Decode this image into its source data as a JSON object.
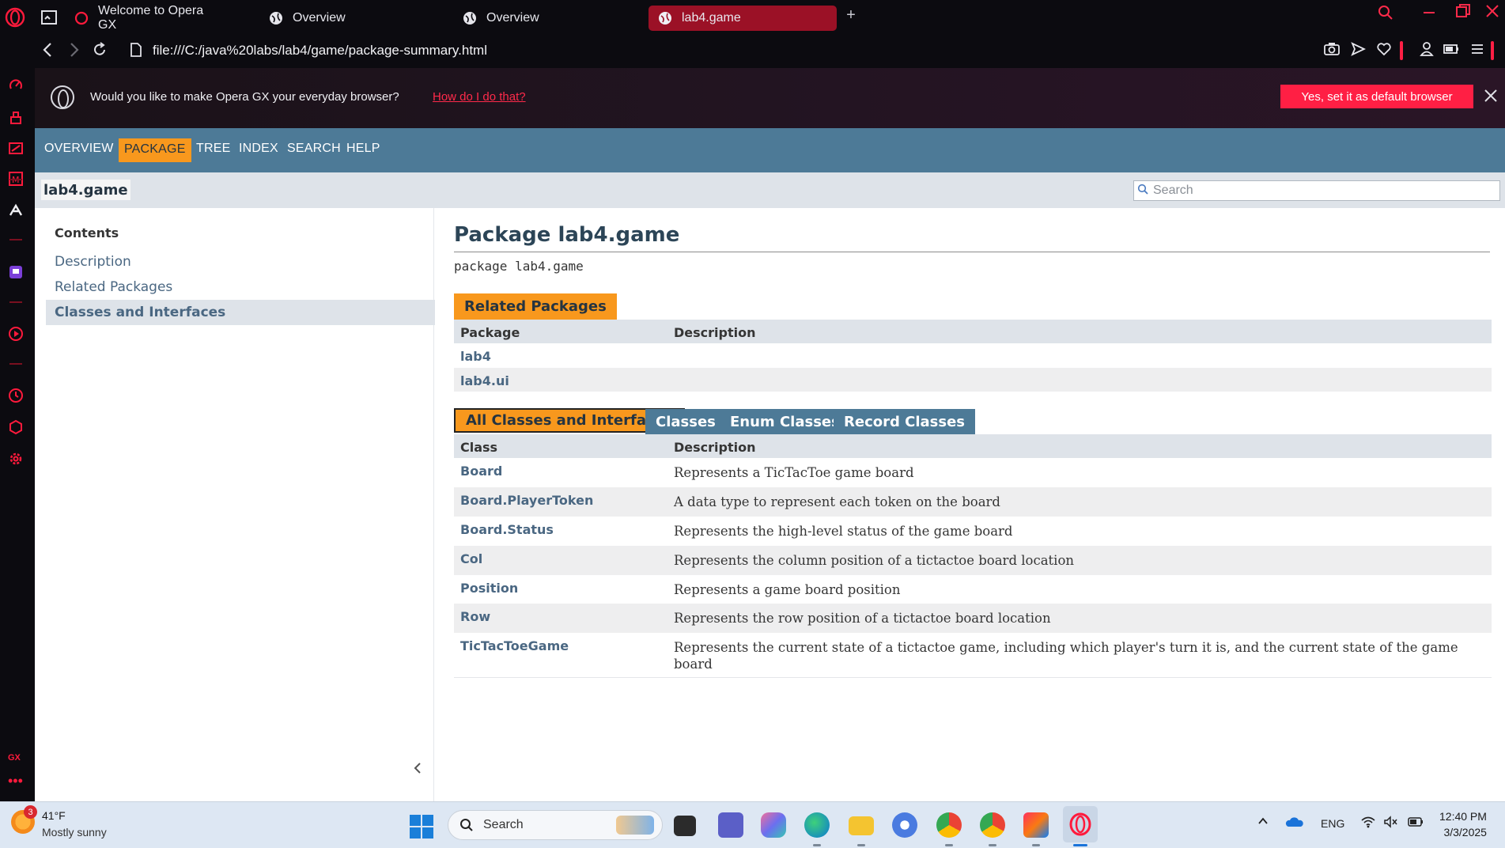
{
  "browser": {
    "tabs": [
      {
        "label": "Welcome to Opera GX",
        "icon": "opera-icon"
      },
      {
        "label": "Overview",
        "icon": "globe-icon"
      },
      {
        "label": "Overview",
        "icon": "globe-icon"
      },
      {
        "label": "lab4.game",
        "icon": "globe-icon",
        "active": true
      }
    ],
    "new_tab_label": "+",
    "url": "file:///C:/java%20labs/lab4/game/package-summary.html",
    "accent": "#ff1f44"
  },
  "notification": {
    "message": "Would you like to make Opera GX your everyday browser?",
    "link": "How do I do that?",
    "button": "Yes, set it as default browser"
  },
  "gx_sidebar": {
    "footer_label": "GX"
  },
  "javadoc": {
    "nav": [
      "OVERVIEW",
      "PACKAGE",
      "TREE",
      "INDEX",
      "SEARCH",
      "HELP"
    ],
    "nav_current": "PACKAGE",
    "subnav_package": "lab4.game",
    "search_placeholder": "Search",
    "toc": {
      "heading": "Contents",
      "items": [
        "Description",
        "Related Packages",
        "Classes and Interfaces"
      ],
      "selected": "Classes and Interfaces"
    },
    "title": "Package lab4.game",
    "signature": "package lab4.game",
    "related": {
      "caption": "Related Packages",
      "headers": [
        "Package",
        "Description"
      ],
      "rows": [
        {
          "name": "lab4",
          "desc": ""
        },
        {
          "name": "lab4.ui",
          "desc": ""
        }
      ]
    },
    "class_tabs": [
      "All Classes and Interfaces",
      "Classes",
      "Enum Classes",
      "Record Classes"
    ],
    "classes": {
      "headers": [
        "Class",
        "Description"
      ],
      "rows": [
        {
          "name": "Board",
          "desc": "Represents a TicTacToe game board"
        },
        {
          "name": "Board.PlayerToken",
          "desc": "A data type to represent each token on the board"
        },
        {
          "name": "Board.Status",
          "desc": "Represents the high-level status of the game board"
        },
        {
          "name": "Col",
          "desc": "Represents the column position of a tictactoe board location"
        },
        {
          "name": "Position",
          "desc": "Represents a game board position"
        },
        {
          "name": "Row",
          "desc": "Represents the row position of a tictactoe board location"
        },
        {
          "name": "TicTacToeGame",
          "desc": "Represents the current state of a tictactoe game, including which player's turn it is, and the current state of the game board"
        }
      ]
    },
    "colors": {
      "nav": "#4d7a97",
      "selected": "#f8981d",
      "subnav": "#dee3e9",
      "link": "#4a6782"
    }
  },
  "taskbar": {
    "weather_badge": "3",
    "temperature": "41°F",
    "weather": "Mostly sunny",
    "search_label": "Search",
    "language": "ENG",
    "time": "12:40 PM",
    "date": "3/3/2025"
  }
}
